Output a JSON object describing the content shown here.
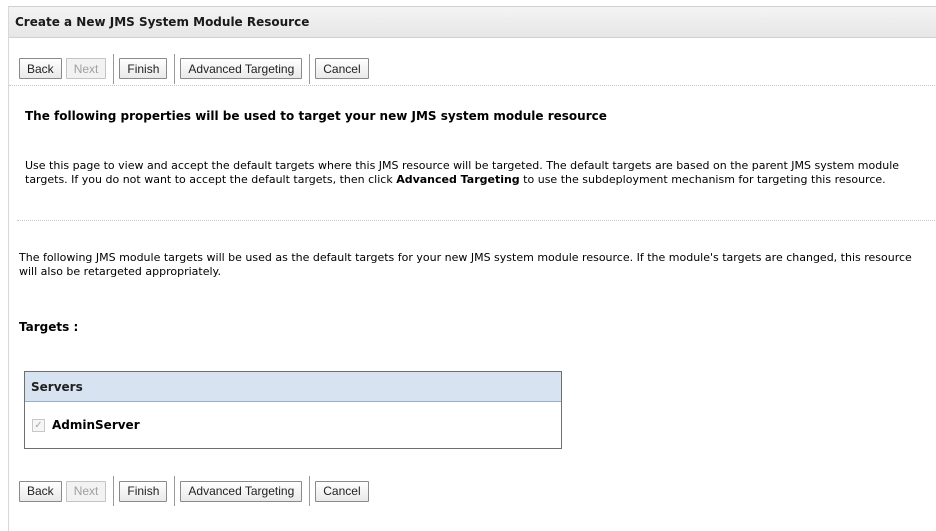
{
  "header": {
    "title": "Create a New JMS System Module Resource"
  },
  "toolbar": {
    "back_label": "Back",
    "next_label": "Next",
    "finish_label": "Finish",
    "advanced_targeting_label": "Advanced Targeting",
    "cancel_label": "Cancel"
  },
  "section": {
    "title": "The following properties will be used to target your new JMS system module resource",
    "desc_before": "Use this page to view and accept the default targets where this JMS resource will be targeted. The default targets are based on the parent JMS system module targets. If you do not want to accept the default targets, then click ",
    "desc_bold": "Advanced Targeting",
    "desc_after": " to use the subdeployment mechanism for targeting this resource."
  },
  "info": {
    "text": "The following JMS module targets will be used as the default targets for your new JMS system module resource. If the module's targets are changed, this resource will also be retargeted appropriately."
  },
  "targets": {
    "label": "Targets :",
    "servers_header": "Servers",
    "servers": [
      {
        "name": "AdminServer",
        "checked": true,
        "disabled": true
      }
    ]
  }
}
